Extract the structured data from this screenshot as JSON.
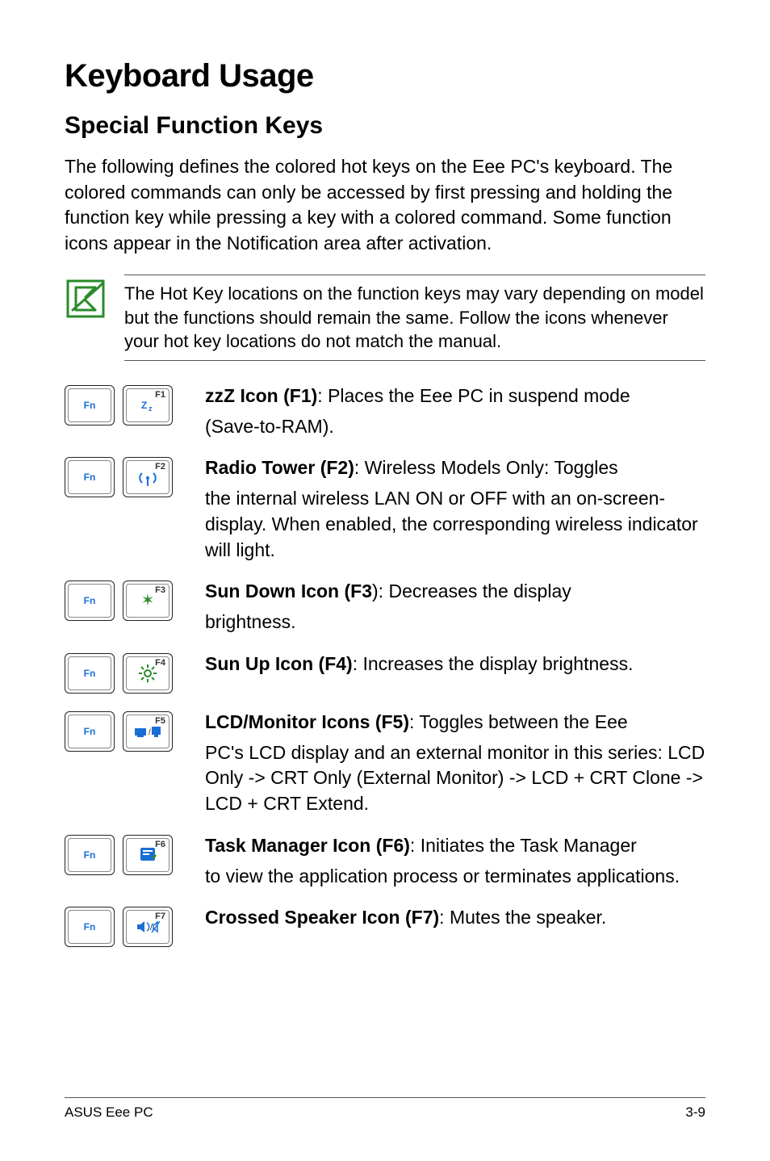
{
  "title": "Keyboard Usage",
  "subtitle": "Special Function Keys",
  "intro": "The following defines the colored hot keys on the Eee PC's keyboard. The colored commands can only be accessed by first pressing and holding the function key while pressing a key with a colored command. Some function icons appear in the Notification area after activation.",
  "note": "The Hot Key locations on the function keys may vary depending on model but the functions should remain the same. Follow the icons whenever your hot key locations do not match the manual.",
  "fn_label": "Fn",
  "items": [
    {
      "key": "F1",
      "icon": "zz",
      "title": "zzZ Icon (F1)",
      "sep": ": ",
      "lead": "Places the Eee PC in suspend mode",
      "rest": " (Save-to-RAM)."
    },
    {
      "key": "F2",
      "icon": "radio",
      "title": "Radio Tower (F2)",
      "sep": ": ",
      "lead": "Wireless Models Only: Toggles",
      "rest": "the internal wireless LAN ON or OFF with an on-screen-display. When enabled, the corresponding wireless indicator will light."
    },
    {
      "key": "F3",
      "icon": "sundown",
      "title": "Sun Down Icon (F3",
      "sep": "): ",
      "lead": "Decreases the display",
      "rest": "brightness."
    },
    {
      "key": "F4",
      "icon": "sunup",
      "title": "Sun Up Icon (F4)",
      "sep": ": ",
      "lead": "Increases the display brightness.",
      "rest": ""
    },
    {
      "key": "F5",
      "icon": "lcd",
      "title": "LCD/Monitor Icons (F5)",
      "sep": ": ",
      "lead": "Toggles between the Eee",
      "rest": "PC's LCD display and an external monitor in this series: LCD Only -> CRT Only (External Monitor) -> LCD + CRT Clone -> LCD + CRT Extend."
    },
    {
      "key": "F6",
      "icon": "task",
      "title": "Task Manager Icon (F6)",
      "sep": ": ",
      "lead": "Initiates the Task Manager",
      "rest": "to view the application process or terminates applications."
    },
    {
      "key": "F7",
      "icon": "speaker",
      "title": "Crossed Speaker Icon (F7)",
      "sep": ": ",
      "lead": "Mutes the speaker.",
      "rest": ""
    }
  ],
  "footer_left": "ASUS Eee PC",
  "footer_right": "3-9"
}
